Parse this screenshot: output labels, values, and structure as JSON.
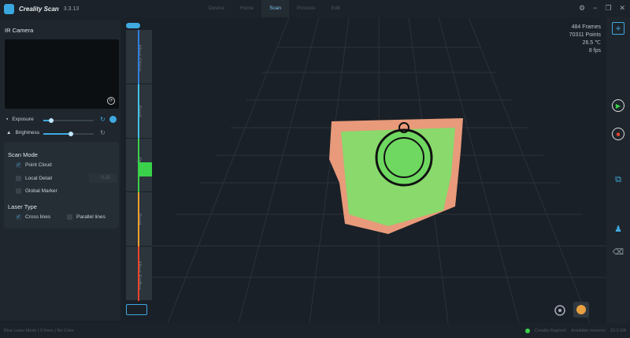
{
  "app": {
    "title": "Creality Scan",
    "version": "3.3.13"
  },
  "tabs": [
    {
      "label": "Device"
    },
    {
      "label": "Home"
    },
    {
      "label": "Scan"
    },
    {
      "label": "Process"
    },
    {
      "label": "Edit"
    }
  ],
  "left": {
    "ir_camera": "IR Camera",
    "exposure": "Exposure",
    "brightness": "Brightness",
    "exposure_value": 0.15,
    "brightness_value": 0.55,
    "scan_mode": "Scan Mode",
    "point_cloud": "Point Cloud",
    "local_detail": "Local Detail",
    "local_detail_value": "0.25",
    "global_marker": "Global Marker",
    "laser_type": "Laser Type",
    "cross_lines": "Cross lines",
    "parallel_lines": "Parallel lines"
  },
  "distance": [
    {
      "label": "Move Closer",
      "color": "#2f7fd8"
    },
    {
      "label": "Good",
      "color": "#3fc2e8"
    },
    {
      "label": "Optimal",
      "color": "#3ad24a"
    },
    {
      "label": "Good",
      "color": "#f0a030"
    },
    {
      "label": "Move Farther",
      "color": "#e8442c"
    }
  ],
  "stats": {
    "frames": "484 Frames",
    "points": "70311 Points",
    "temp": "26.5 ℃",
    "fps": "8 fps"
  },
  "status": {
    "left": "Blue Laser Mode | 0.5mm | No Color",
    "device": "Creality RaptorX",
    "memory_label": "Available memory",
    "memory": "23.2 GB"
  }
}
